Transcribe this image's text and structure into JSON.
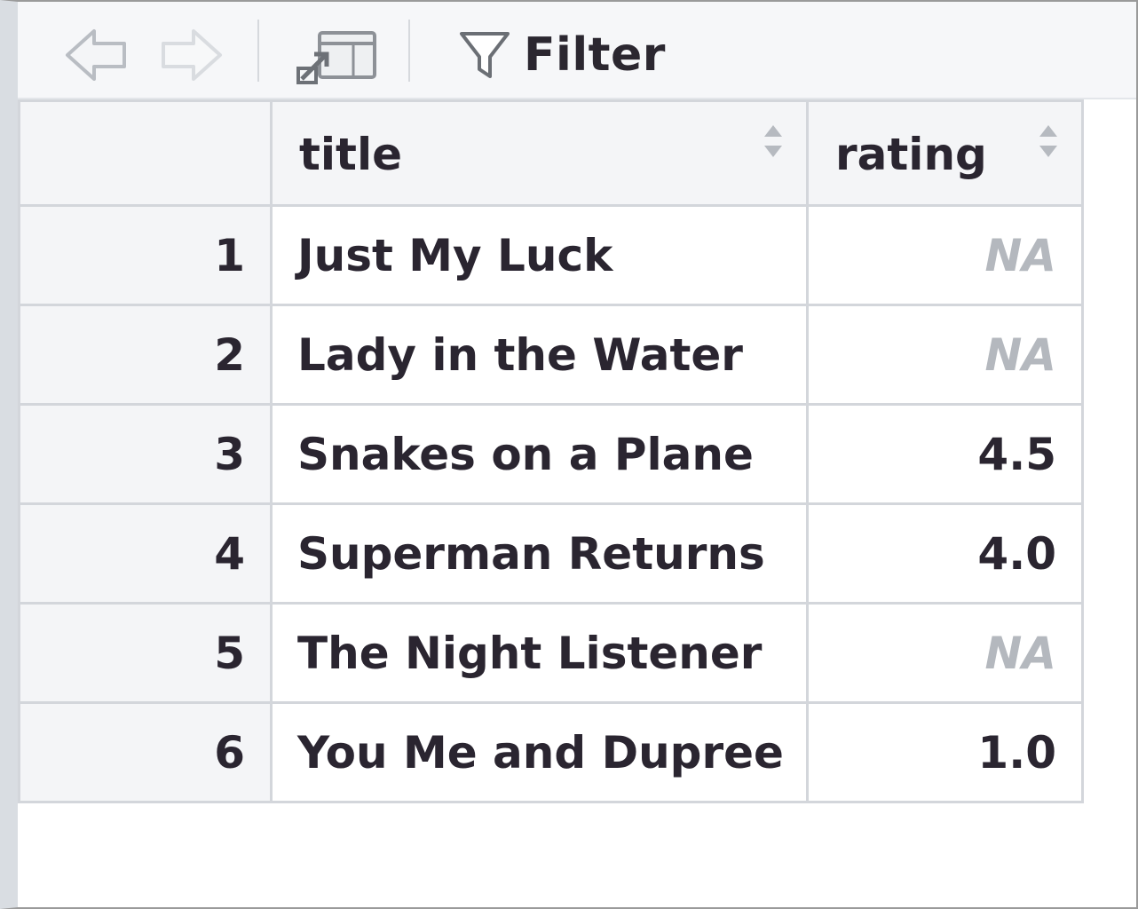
{
  "toolbar": {
    "back_icon": "arrow-left-icon",
    "forward_icon": "arrow-right-icon",
    "popout_icon": "popout-window-icon",
    "filter_icon": "funnel-icon",
    "filter_label": "Filter"
  },
  "table": {
    "columns": [
      {
        "label": "title",
        "sort_icon": "sort-arrows-icon"
      },
      {
        "label": "rating",
        "sort_icon": "sort-arrows-icon"
      }
    ],
    "rows": [
      {
        "num": "1",
        "title": "Just My Luck",
        "rating": "NA"
      },
      {
        "num": "2",
        "title": "Lady in the Water",
        "rating": "NA"
      },
      {
        "num": "3",
        "title": "Snakes on a Plane",
        "rating": "4.5"
      },
      {
        "num": "4",
        "title": "Superman Returns",
        "rating": "4.0"
      },
      {
        "num": "5",
        "title": "The Night Listener",
        "rating": "NA"
      },
      {
        "num": "6",
        "title": "You Me and Dupree",
        "rating": "1.0"
      }
    ]
  },
  "colors": {
    "na_text": "#b4b8be",
    "text": "#2a2530",
    "header_bg": "#f4f5f7",
    "border": "#d3d6db"
  }
}
